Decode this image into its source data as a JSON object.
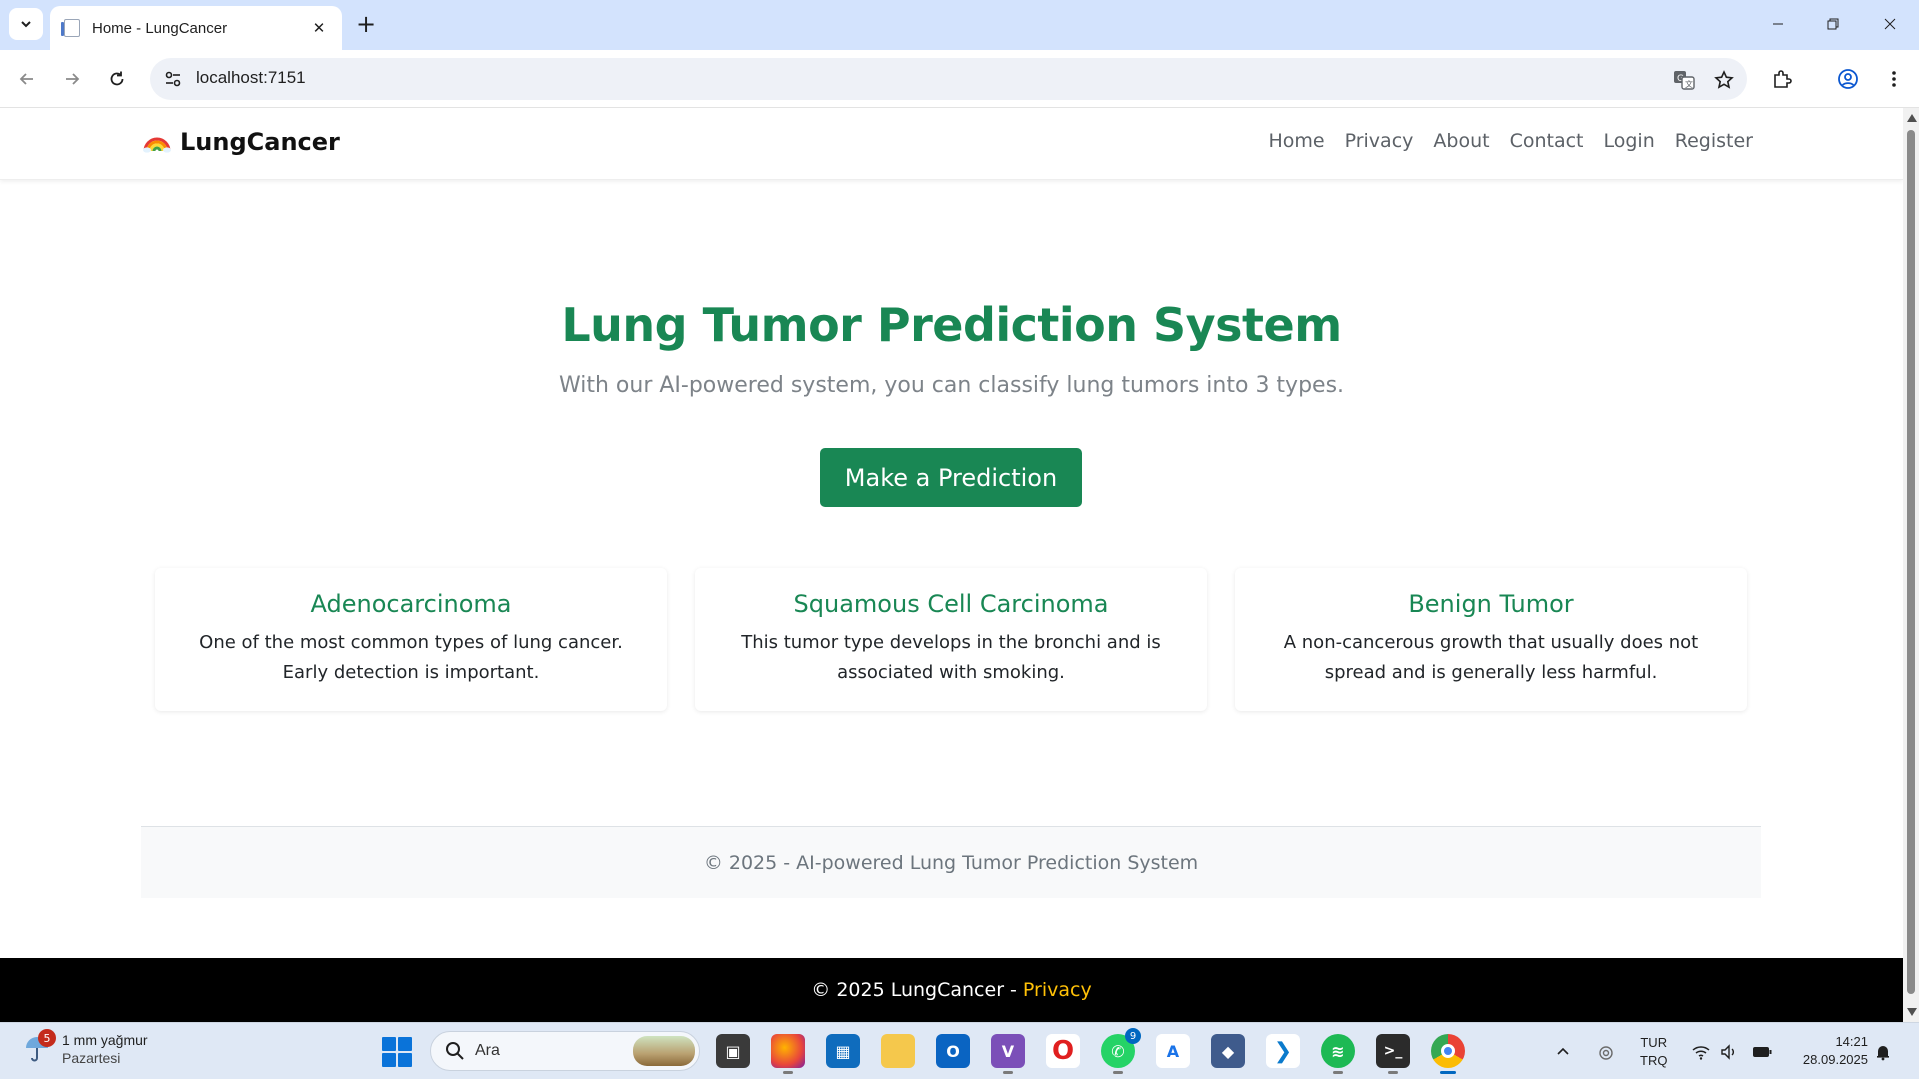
{
  "browser": {
    "tab_title": "Home - LungCancer",
    "url": "localhost:7151"
  },
  "site": {
    "brand": "LungCancer",
    "nav": [
      "Home",
      "Privacy",
      "About",
      "Contact",
      "Login",
      "Register"
    ],
    "hero_title": "Lung Tumor Prediction System",
    "hero_subtitle": "With our AI-powered system, you can classify lung tumors into 3 types.",
    "cta_label": "Make a Prediction",
    "cards": [
      {
        "title": "Adenocarcinoma",
        "text": "One of the most common types of lung cancer. Early detection is important."
      },
      {
        "title": "Squamous Cell Carcinoma",
        "text": "This tumor type develops in the bronchi and is associated with smoking."
      },
      {
        "title": "Benign Tumor",
        "text": "A non-cancerous growth that usually does not spread and is generally less harmful."
      }
    ],
    "inner_footer": "© 2025 - AI-powered Lung Tumor Prediction System",
    "outer_footer_text": "© 2025 LungCancer -",
    "outer_footer_link": "Privacy"
  },
  "taskbar": {
    "weather_badge": "5",
    "weather_title": "1 mm yağmur",
    "weather_day": "Pazartesi",
    "search_label": "Ara",
    "whatsapp_badge": "9",
    "lang_line1": "TUR",
    "lang_line2": "TRQ",
    "time": "14:21",
    "date": "28.09.2025"
  },
  "colors": {
    "accent": "#198754",
    "footer_link": "#ffc107",
    "tabstrip": "#d3e3fd"
  }
}
